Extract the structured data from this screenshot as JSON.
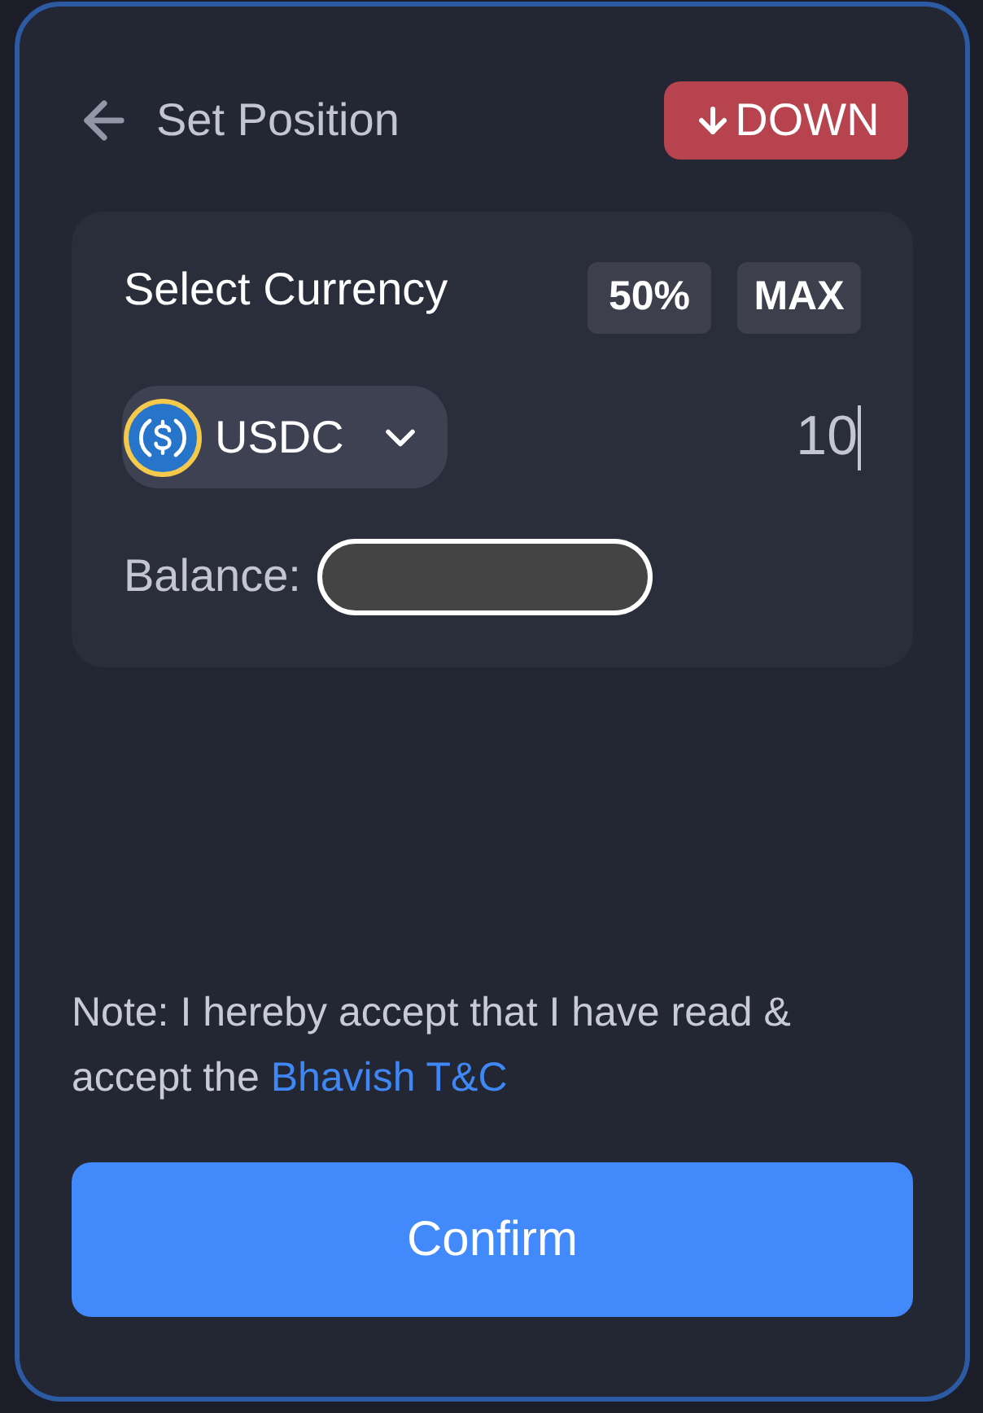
{
  "header": {
    "title": "Set Position",
    "direction_badge": {
      "kind": "down",
      "label": "DOWN"
    }
  },
  "currency_panel": {
    "title": "Select Currency",
    "quick_buttons": [
      "50%",
      "MAX"
    ],
    "currency": {
      "symbol": "USDC"
    },
    "amount": {
      "value": "10",
      "focused": true
    },
    "balance": {
      "label": "Balance:",
      "redacted": true
    }
  },
  "note": {
    "text": "Note: I hereby accept that I have read & accept the",
    "link": "Bhavish T&C"
  },
  "confirm_button": {
    "label": "Confirm"
  }
}
